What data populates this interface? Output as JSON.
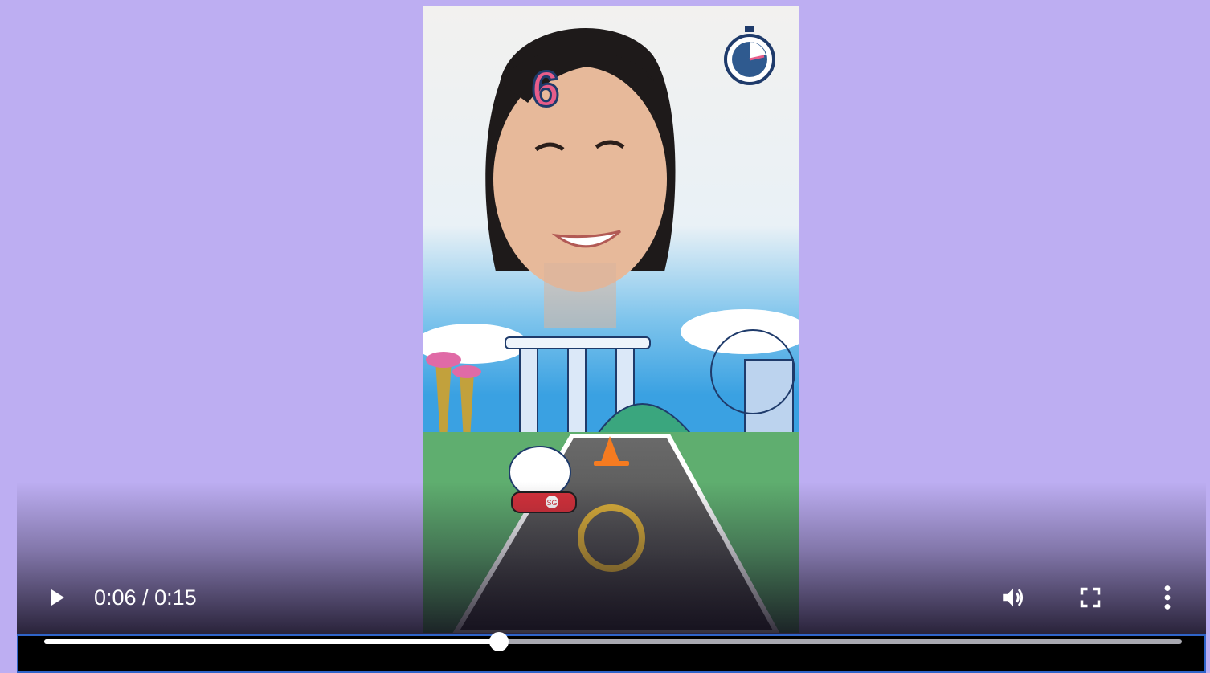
{
  "video": {
    "score_text": "6",
    "kart_badge": "SG"
  },
  "player": {
    "current_time": "0:06",
    "separator": "/",
    "duration": "0:15",
    "progress_fraction": 0.4
  },
  "icons": {
    "play": "play-icon",
    "volume": "volume-icon",
    "fullscreen": "fullscreen-icon",
    "more": "more-options-icon",
    "timer": "stopwatch-icon"
  },
  "colors": {
    "page_background": "#bdaef2",
    "focus_outline": "#2f64c8",
    "score_pink": "#e85d8a"
  }
}
